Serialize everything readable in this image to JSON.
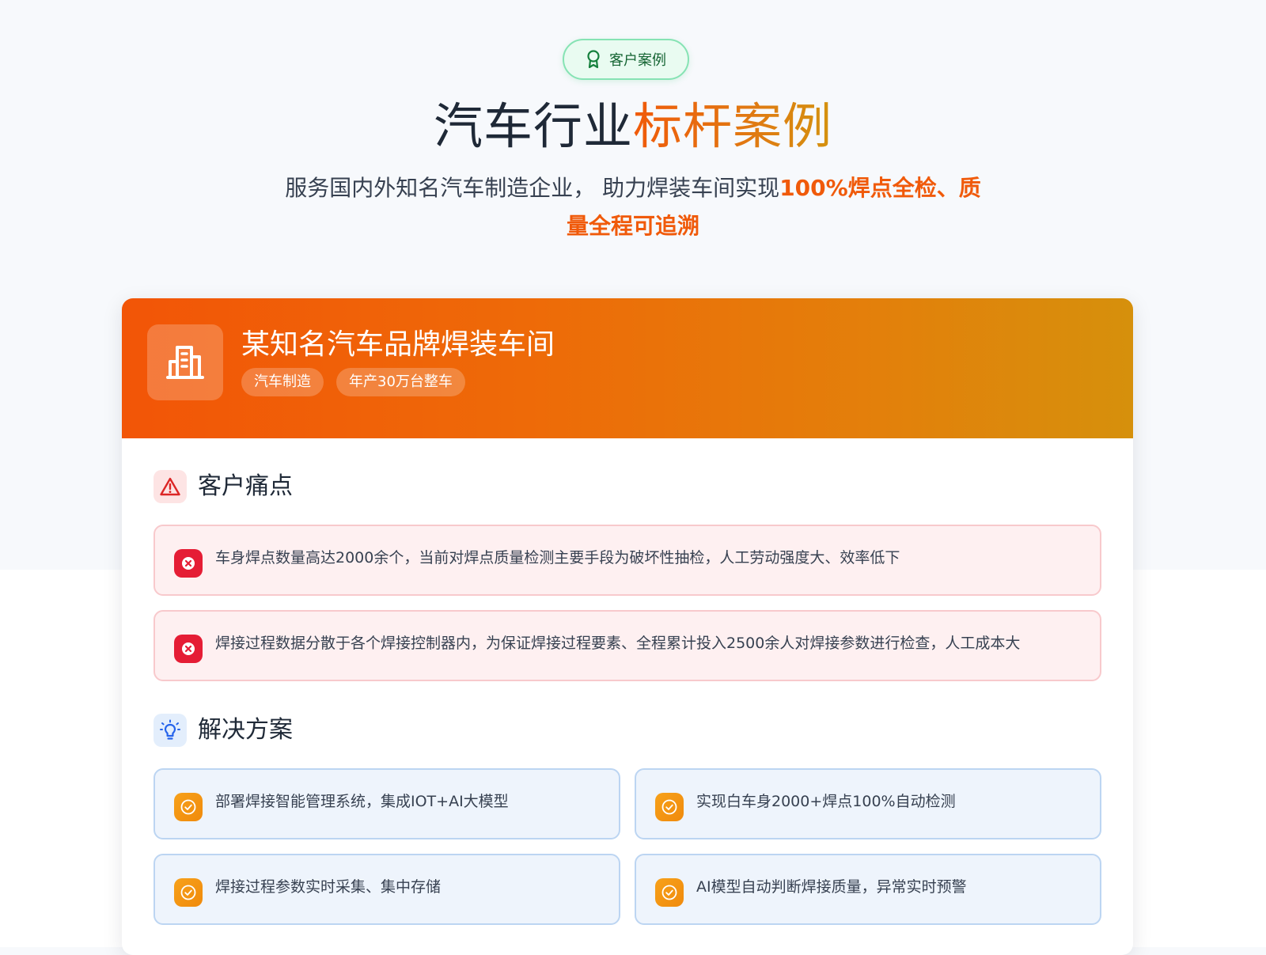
{
  "badge": {
    "label": "客户案例",
    "icon": "award-ribbon-icon"
  },
  "hero": {
    "title_main": "汽车行业",
    "title_accent": "标杆案例",
    "subtitle_main": "服务国内外知名汽车制造企业， 助力焊装车间实现",
    "subtitle_highlight": "100%焊点全检、质量全程可追溯"
  },
  "card": {
    "icon": "building-icon",
    "title": "某知名汽车品牌焊装车间",
    "tags": [
      "汽车制造",
      "年产30万台整车"
    ]
  },
  "pain_points": {
    "title": "客户痛点",
    "icon": "alert-triangle-icon",
    "items": [
      "车身焊点数量高达2000余个，当前对焊点质量检测主要手段为破坏性抽检，人工劳动强度大、效率低下",
      "焊接过程数据分散于各个焊接控制器内，为保证焊接过程要素、全程累计投入2500余人对焊接参数进行检查，人工成本大"
    ]
  },
  "solutions": {
    "title": "解决方案",
    "icon": "lightbulb-icon",
    "items": [
      "部署焊接智能管理系统，集成IOT+AI大模型",
      "实现白车身2000+焊点100%自动检测",
      "焊接过程参数实时采集、集中存储",
      "AI模型自动判断焊接质量，异常实时预警"
    ]
  },
  "colors": {
    "accent": "#f05a0a",
    "header_gradient_start": "#f25507",
    "header_gradient_end": "#d6900c",
    "pain_border": "#f8c9cc",
    "pain_bg": "#fef0f1",
    "pain_icon": "#e51d35",
    "solution_border": "#bcd5f2",
    "solution_bg": "#eef4fc",
    "badge_border": "#86e3b4",
    "badge_bg": "#e9fbf1"
  }
}
